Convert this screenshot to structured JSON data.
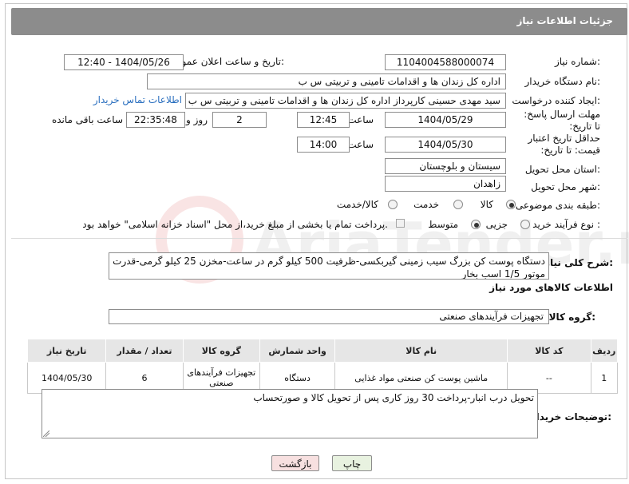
{
  "header": {
    "title": "جزئیات اطلاعات نیاز"
  },
  "fields": {
    "need_number_label": "شماره نیاز:",
    "need_number": "1104004588000074",
    "announce_label": "تاریخ و ساعت اعلان عمومی:",
    "announce_value": "1404/05/26 - 12:40",
    "buyer_org_label": "نام دستگاه خریدار:",
    "buyer_org": "اداره کل زندان ها و اقدامات تامینی و تربیتی س ب",
    "creator_label": "ایجاد کننده درخواست:",
    "creator": "سید مهدی حسینی کارپرداز اداره کل زندان ها و اقدامات تامینی و تربیتی س ب",
    "contact_link": "اطلاعات تماس خریدار",
    "reply_deadline_label": "مهلت ارسال پاسخ: تا تاریخ:",
    "reply_date": "1404/05/29",
    "time_label": "ساعت",
    "reply_time": "12:45",
    "days_value": "2",
    "days_label": "روز و",
    "remaining_time": "22:35:48",
    "remaining_label": "ساعت باقی مانده",
    "price_validity_label": "حداقل تاریخ اعتبار قیمت: تا تاریخ:",
    "price_date": "1404/05/30",
    "price_time": "14:00",
    "province_label": "استان محل تحویل:",
    "province": "سیستان و بلوچستان",
    "city_label": "شهر محل تحویل:",
    "city": "زاهدان",
    "category_label": "طبقه بندی موضوعی:",
    "category_options": [
      "کالا",
      "خدمت",
      "کالا/خدمت"
    ],
    "process_label": "نوع فرآیند خرید :",
    "process_options": [
      "جزیی",
      "متوسط"
    ],
    "payment_note": "پرداخت تمام یا بخشی از مبلغ خرید،از محل \"اسناد خزانه اسلامی\" خواهد بود."
  },
  "description": {
    "label": "شرح کلی نیاز:",
    "text": "دستگاه پوست کن بزرگ سیب زمینی گیربکسی-ظرفیت 500 کیلو گرم در ساعت-مخزن 25 کیلو گرمی-قدرت موتور 1/5 اسب بخار"
  },
  "goods": {
    "section_title": "اطلاعات کالاهای مورد نیاز",
    "group_label": "گروه کالا:",
    "group_value": "تجهیزات فرآیندهای صنعتی",
    "columns": [
      "ردیف",
      "کد کالا",
      "نام کالا",
      "واحد شمارش",
      "گروه کالا",
      "تعداد / مقدار",
      "تاریخ نیاز"
    ],
    "rows": [
      [
        "1",
        "--",
        "ماشین پوست کن صنعتی مواد غذایی",
        "دستگاه",
        "تجهیزات فرآیندهای صنعتی",
        "6",
        "1404/05/30"
      ]
    ]
  },
  "buyer_notes": {
    "label": "توضیحات خریدار:",
    "text": "تحویل درب انبار-پرداخت 30 روز کاری پس از تحویل کالا و صورتحساب"
  },
  "buttons": {
    "print": "چاپ",
    "back": "بازگشت"
  },
  "watermark": "AriaTender.neT"
}
